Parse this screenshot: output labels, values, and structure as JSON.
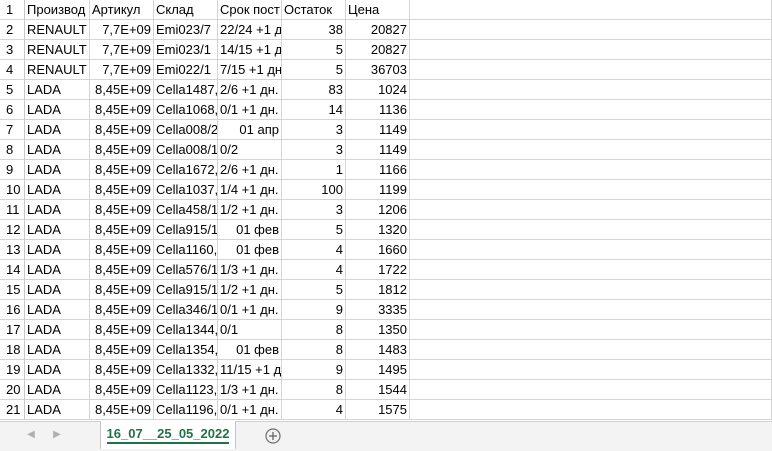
{
  "sheet": {
    "tab_name": "16_07__25_05_2022",
    "rows": [
      {
        "n": "1",
        "a": "Производ",
        "b": "Артикул",
        "c": "Склад",
        "d": "Срок пост",
        "e": "Остаток",
        "f": "Цена"
      },
      {
        "n": "2",
        "a": "RENAULT",
        "b": "7,7E+09",
        "c": "Emi023/7",
        "d": "22/24 +1 д",
        "e": "38",
        "f": "20827"
      },
      {
        "n": "3",
        "a": "RENAULT",
        "b": "7,7E+09",
        "c": "Emi023/1",
        "d": "14/15 +1 д",
        "e": "5",
        "f": "20827"
      },
      {
        "n": "4",
        "a": "RENAULT",
        "b": "7,7E+09",
        "c": "Emi022/1",
        "d": "7/15 +1 дн",
        "e": "5",
        "f": "36703"
      },
      {
        "n": "5",
        "a": "LADA",
        "b": "8,45E+09",
        "c": "Cella1487,",
        "d": "2/6 +1 дн.",
        "e": "83",
        "f": "1024"
      },
      {
        "n": "6",
        "a": "LADA",
        "b": "8,45E+09",
        "c": "Cella1068,",
        "d": "0/1 +1 дн.",
        "e": "14",
        "f": "1136"
      },
      {
        "n": "7",
        "a": "LADA",
        "b": "8,45E+09",
        "c": "Cella008/2",
        "d": "01 апр",
        "e": "3",
        "f": "1149"
      },
      {
        "n": "8",
        "a": "LADA",
        "b": "8,45E+09",
        "c": "Cella008/1",
        "d": "0/2",
        "e": "3",
        "f": "1149"
      },
      {
        "n": "9",
        "a": "LADA",
        "b": "8,45E+09",
        "c": "Cella1672,",
        "d": "2/6 +1 дн.",
        "e": "1",
        "f": "1166"
      },
      {
        "n": "10",
        "a": "LADA",
        "b": "8,45E+09",
        "c": "Cella1037,",
        "d": "1/4 +1 дн.",
        "e": "100",
        "f": "1199"
      },
      {
        "n": "11",
        "a": "LADA",
        "b": "8,45E+09",
        "c": "Cella458/1",
        "d": "1/2 +1 дн.",
        "e": "3",
        "f": "1206"
      },
      {
        "n": "12",
        "a": "LADA",
        "b": "8,45E+09",
        "c": "Cella915/1",
        "d": "01 фев",
        "e": "5",
        "f": "1320"
      },
      {
        "n": "13",
        "a": "LADA",
        "b": "8,45E+09",
        "c": "Cella1160,",
        "d": "01 фев",
        "e": "4",
        "f": "1660"
      },
      {
        "n": "14",
        "a": "LADA",
        "b": "8,45E+09",
        "c": "Cella576/1",
        "d": "1/3 +1 дн.",
        "e": "4",
        "f": "1722"
      },
      {
        "n": "15",
        "a": "LADA",
        "b": "8,45E+09",
        "c": "Cella915/1",
        "d": "1/2 +1 дн.",
        "e": "5",
        "f": "1812"
      },
      {
        "n": "16",
        "a": "LADA",
        "b": "8,45E+09",
        "c": "Cella346/1",
        "d": "0/1 +1 дн.",
        "e": "9",
        "f": "3335"
      },
      {
        "n": "17",
        "a": "LADA",
        "b": "8,45E+09",
        "c": "Cella1344,",
        "d": "0/1",
        "e": "8",
        "f": "1350"
      },
      {
        "n": "18",
        "a": "LADA",
        "b": "8,45E+09",
        "c": "Cella1354,",
        "d": "01 фев",
        "e": "8",
        "f": "1483"
      },
      {
        "n": "19",
        "a": "LADA",
        "b": "8,45E+09",
        "c": "Cella1332,",
        "d": "11/15 +1 д",
        "e": "9",
        "f": "1495"
      },
      {
        "n": "20",
        "a": "LADA",
        "b": "8,45E+09",
        "c": "Cella1123,",
        "d": "1/3 +1 дн.",
        "e": "8",
        "f": "1544"
      },
      {
        "n": "21",
        "a": "LADA",
        "b": "8,45E+09",
        "c": "Cella1196,",
        "d": "0/1 +1 дн.",
        "e": "4",
        "f": "1575"
      }
    ]
  },
  "icons": {
    "prev": "chevron-left-icon",
    "next": "chevron-right-icon",
    "add": "add-sheet-icon"
  },
  "colors": {
    "accent": "#217346",
    "gridline": "#d4d4d4",
    "sheetbar": "#f3f3f3"
  }
}
